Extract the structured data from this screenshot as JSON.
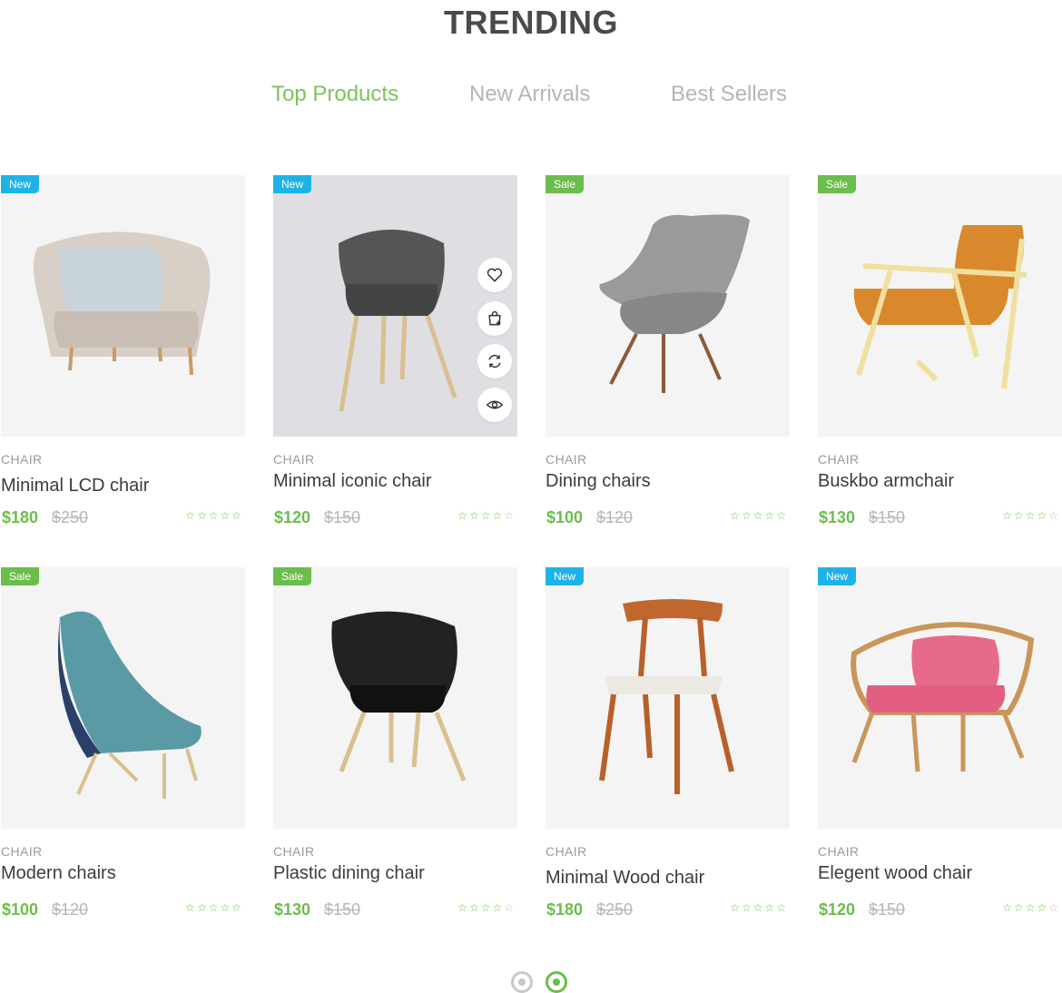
{
  "title": "TRENDING",
  "tabs": [
    {
      "label": "Top Products",
      "active": true
    },
    {
      "label": "New Arrivals",
      "active": false
    },
    {
      "label": "Best Sellers",
      "active": false
    }
  ],
  "products": [
    {
      "badge": "New",
      "category": "CHAIR",
      "name": "Minimal LCD chair",
      "price": "$180",
      "old_price": "$250",
      "rating": 5
    },
    {
      "badge": "New",
      "category": "CHAIR",
      "name": "Minimal iconic chair",
      "price": "$120",
      "old_price": "$150",
      "rating": 4
    },
    {
      "badge": "Sale",
      "category": "CHAIR",
      "name": "Dining chairs",
      "price": "$100",
      "old_price": "$120",
      "rating": 5
    },
    {
      "badge": "Sale",
      "category": "CHAIR",
      "name": "Buskbo armchair",
      "price": "$130",
      "old_price": "$150",
      "rating": 4
    },
    {
      "badge": "Sale",
      "category": "CHAIR",
      "name": "Modern chairs",
      "price": "$100",
      "old_price": "$120",
      "rating": 0
    },
    {
      "badge": "Sale",
      "category": "CHAIR",
      "name": "Plastic dining chair",
      "price": "$130",
      "old_price": "$150",
      "rating": 4
    },
    {
      "badge": "New",
      "category": "CHAIR",
      "name": "Minimal Wood chair",
      "price": "$180",
      "old_price": "$250",
      "rating": 5
    },
    {
      "badge": "New",
      "category": "CHAIR",
      "name": "Elegent wood chair",
      "price": "$120",
      "old_price": "$150",
      "rating": 4
    }
  ],
  "hover_actions": [
    "heart-icon",
    "bag-add-icon",
    "refresh-icon",
    "eye-icon"
  ],
  "pagination": {
    "count": 2,
    "active_index": 1
  },
  "colors": {
    "accent": "#6bbd4c",
    "badge_new": "#1eb3e8",
    "badge_sale": "#6bbd4c",
    "tab_inactive": "#b5b5b5"
  }
}
